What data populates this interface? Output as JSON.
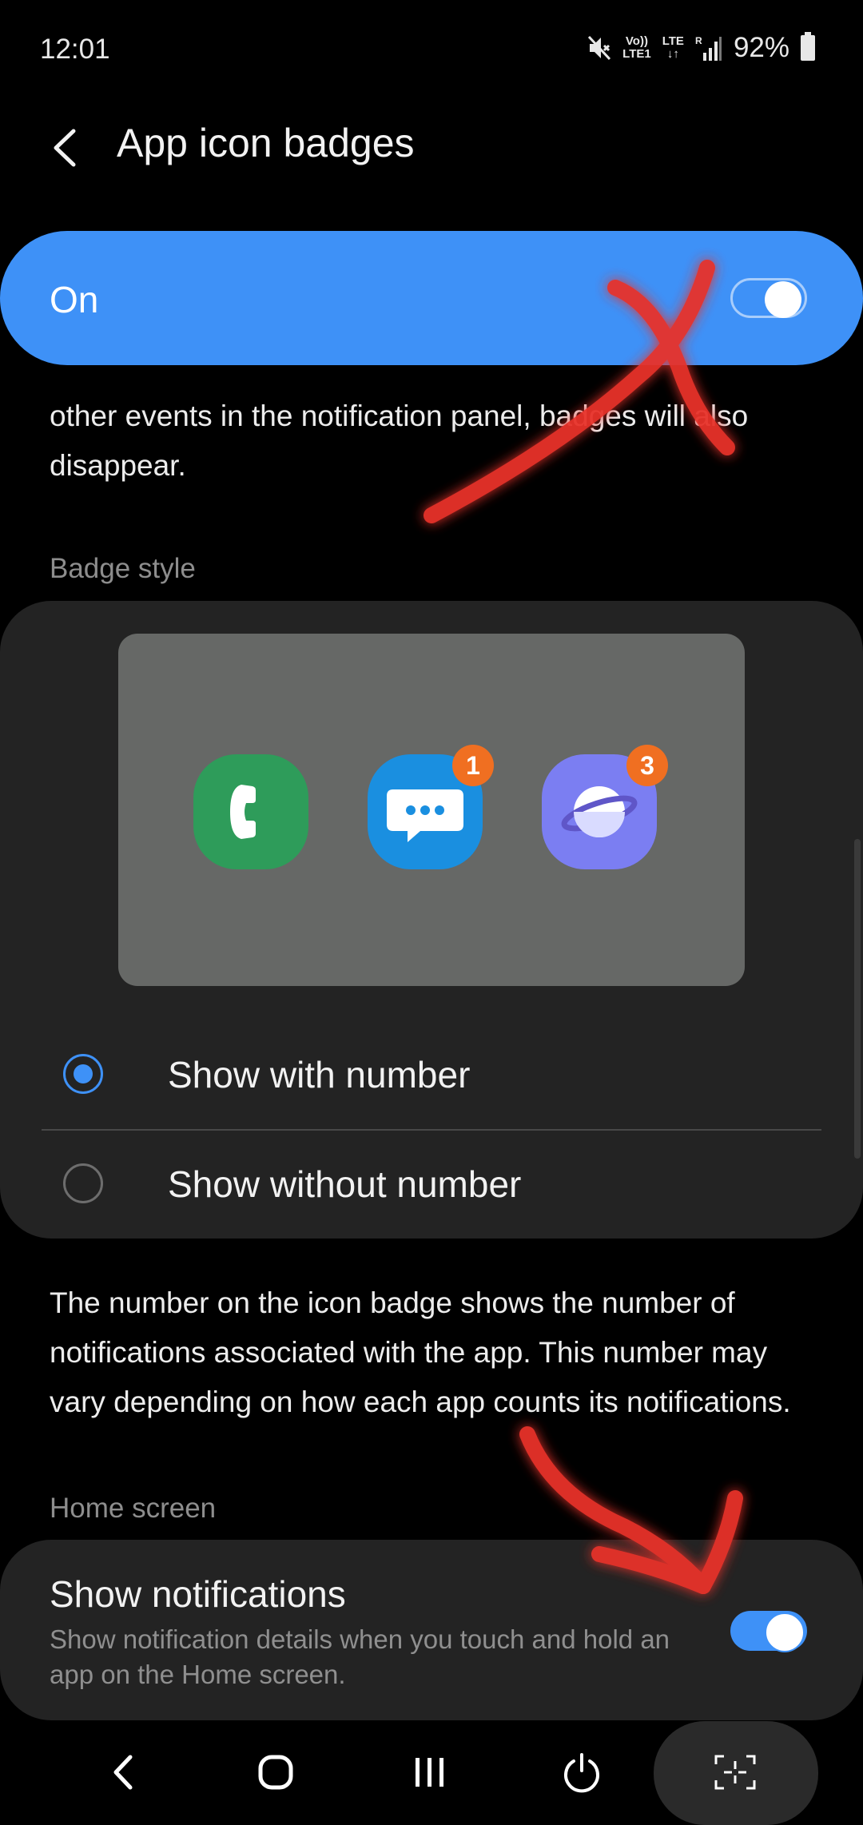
{
  "status_bar": {
    "time": "12:01",
    "volte_line1": "Vo))",
    "volte_line2": "LTE1",
    "lte_line1": "LTE",
    "lte_line2": "R",
    "battery_text": "92%"
  },
  "header": {
    "title": "App icon badges"
  },
  "master_switch": {
    "label": "On",
    "state": "on"
  },
  "top_description": "other events in the notification panel, badges will also disappear.",
  "badge_style": {
    "section_label": "Badge style",
    "preview_icons": [
      {
        "app": "phone-icon",
        "color": "#2e9c5a",
        "badge": ""
      },
      {
        "app": "messages-icon",
        "color": "#1a8fe0",
        "badge": "1"
      },
      {
        "app": "internet-icon",
        "color": "#7b7ef2",
        "badge": "3"
      }
    ],
    "options": [
      {
        "label": "Show with number",
        "selected": true
      },
      {
        "label": "Show without number",
        "selected": false
      }
    ]
  },
  "badge_description": "The number on the icon badge shows the number of notifications associated with the app. This number may vary depending on how each app counts its notifications.",
  "home_screen": {
    "section_label": "Home screen",
    "show_notifications": {
      "title": "Show notifications",
      "subtitle": "Show notification details when you touch and hold an app on the Home screen.",
      "state": "on"
    }
  },
  "colors": {
    "accent": "#3e91f7",
    "background": "#000000",
    "card": "#232323",
    "badge_orange": "#f06f21",
    "annotation_red": "#e8322b"
  },
  "nav_bar": {
    "buttons": [
      "back-icon",
      "home-icon",
      "recents-icon",
      "power-icon",
      "screen-capture-icon"
    ]
  }
}
